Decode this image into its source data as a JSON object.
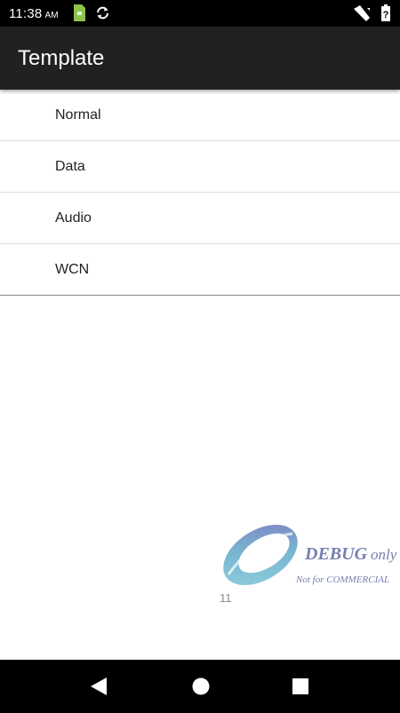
{
  "status_bar": {
    "time": "11:38",
    "ampm": "AM",
    "icons": [
      "sim-card-icon",
      "sync-icon",
      "signal-icon",
      "battery-icon"
    ]
  },
  "app_bar": {
    "title": "Template"
  },
  "menu": {
    "items": [
      {
        "label": "Normal"
      },
      {
        "label": "Data"
      },
      {
        "label": "Audio"
      },
      {
        "label": "WCN"
      }
    ]
  },
  "watermark": {
    "main": "DEBUG",
    "suffix": "only",
    "sub": "Not for COMMERCIAL"
  },
  "page_number": "11",
  "nav_bar": {
    "buttons": [
      "back-icon",
      "home-icon",
      "recents-icon"
    ]
  },
  "colors": {
    "status_bar": "#000000",
    "app_bar": "#212121",
    "nav_bar": "#000000",
    "sim_icon": "#8bc34a",
    "watermark": "#7680b0"
  }
}
